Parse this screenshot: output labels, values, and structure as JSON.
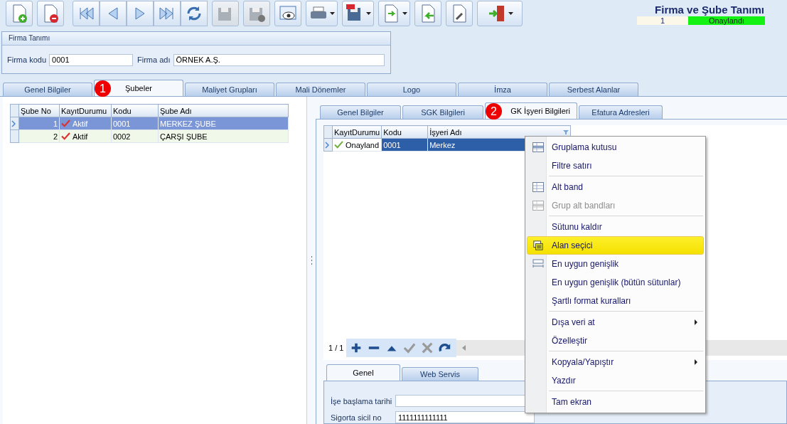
{
  "toolbar": [
    {
      "kind": "new",
      "disabled": false,
      "dropdown": false,
      "group": false
    },
    {
      "kind": "delete",
      "disabled": false,
      "dropdown": false,
      "group": false
    },
    {
      "kind": "first",
      "disabled": false,
      "dropdown": false,
      "group": true
    },
    {
      "kind": "prev",
      "disabled": false,
      "dropdown": false,
      "group": true
    },
    {
      "kind": "next",
      "disabled": false,
      "dropdown": false,
      "group": true
    },
    {
      "kind": "last",
      "disabled": false,
      "dropdown": false,
      "group": true
    },
    {
      "kind": "refresh",
      "disabled": false,
      "dropdown": false,
      "group": true
    },
    {
      "kind": "save",
      "disabled": true,
      "dropdown": false,
      "group": false
    },
    {
      "kind": "save-cancel",
      "disabled": true,
      "dropdown": false,
      "group": false
    },
    {
      "kind": "preview",
      "disabled": false,
      "dropdown": false,
      "group": false
    },
    {
      "kind": "print",
      "disabled": false,
      "dropdown": true,
      "group": false
    },
    {
      "kind": "pdf",
      "disabled": false,
      "dropdown": true,
      "group": false
    },
    {
      "kind": "copy",
      "disabled": false,
      "dropdown": true,
      "group": false
    },
    {
      "kind": "back",
      "disabled": false,
      "dropdown": false,
      "group": false
    },
    {
      "kind": "tools",
      "disabled": false,
      "dropdown": false,
      "group": false
    },
    {
      "kind": "exit",
      "disabled": false,
      "dropdown": true,
      "group": false
    }
  ],
  "window": {
    "title": "Firma ve Şube Tanımı",
    "record": "1",
    "status": "Onaylandı"
  },
  "firma": {
    "title": "Firma Tanımı",
    "code_label": "Firma kodu",
    "code": "0001",
    "name_label": "Firma adı",
    "name": "ÖRNEK A.Ş."
  },
  "tabs": [
    {
      "label": "Genel Bilgiler",
      "selected": false
    },
    {
      "label": "Şubeler",
      "selected": true
    },
    {
      "label": "Maliyet Grupları",
      "selected": false
    },
    {
      "label": "Mali Dönemler",
      "selected": false
    },
    {
      "label": "Logo",
      "selected": false
    },
    {
      "label": "İmza",
      "selected": false
    },
    {
      "label": "Serbest Alanlar",
      "selected": false
    }
  ],
  "annotations": [
    {
      "text": "1"
    },
    {
      "text": "2"
    }
  ],
  "branches": {
    "columns": [
      "Şube No",
      "KayıtDurumu",
      "Kodu",
      "Şube Adı"
    ],
    "rows": [
      {
        "selected": true,
        "no": "1",
        "status": "Aktif",
        "code": "0001",
        "name": "MERKEZ ŞUBE"
      },
      {
        "selected": false,
        "no": "2",
        "status": "Aktif",
        "code": "0002",
        "name": "ÇARŞI ŞUBE"
      }
    ]
  },
  "sub_tabs": [
    {
      "label": "Genel Bilgiler",
      "selected": false
    },
    {
      "label": "SGK Bilgileri",
      "selected": false
    },
    {
      "label": "GK İşyeri Bilgileri",
      "selected": true
    },
    {
      "label": "Efatura Adresleri",
      "selected": false
    }
  ],
  "workplaces": {
    "columns": [
      "KayıtDurumu",
      "Kodu",
      "İşyeri Adı"
    ],
    "rows": [
      {
        "selected": true,
        "status": "Onayland",
        "code": "0001",
        "name": "Merkez"
      }
    ],
    "position": "1 / 1",
    "nav": [
      {
        "kind": "add",
        "disabled": false
      },
      {
        "kind": "remove",
        "disabled": false
      },
      {
        "kind": "up",
        "disabled": false
      },
      {
        "kind": "check",
        "disabled": true
      },
      {
        "kind": "cancel",
        "disabled": true
      },
      {
        "kind": "redo",
        "disabled": false
      }
    ]
  },
  "detail_tabs": [
    {
      "label": "Genel",
      "selected": true
    },
    {
      "label": "Web Servis",
      "selected": false
    }
  ],
  "detail_fields": [
    {
      "label": "İşe başlama tarihi"
    },
    {
      "label": "Sigorta sicil no",
      "value": "1111111111111"
    }
  ],
  "context_menu": [
    {
      "label": "Gruplama kutusu",
      "disabled": false,
      "selected": false,
      "submenu": false,
      "separator_before": false
    },
    {
      "label": "Filtre satırı",
      "disabled": false,
      "selected": false,
      "submenu": false,
      "separator_before": false
    },
    {
      "label": "Alt band",
      "disabled": false,
      "selected": false,
      "submenu": false,
      "separator_before": true
    },
    {
      "label": "Grup alt bandları",
      "disabled": true,
      "selected": false,
      "submenu": false,
      "separator_before": false
    },
    {
      "label": "Sütunu kaldır",
      "disabled": false,
      "selected": false,
      "submenu": false,
      "separator_before": true
    },
    {
      "label": "Alan seçici",
      "disabled": false,
      "selected": true,
      "submenu": false,
      "separator_before": false
    },
    {
      "label": "En uygun genişlik",
      "disabled": false,
      "selected": false,
      "submenu": false,
      "separator_before": false
    },
    {
      "label": "En uygun genişlik (bütün sütunlar)",
      "disabled": false,
      "selected": false,
      "submenu": false,
      "separator_before": false
    },
    {
      "label": "Şartlı format kuralları",
      "disabled": false,
      "selected": false,
      "submenu": false,
      "separator_before": false
    },
    {
      "label": "Dışa veri at",
      "disabled": false,
      "selected": false,
      "submenu": true,
      "separator_before": true
    },
    {
      "label": "Özelleştir",
      "disabled": false,
      "selected": false,
      "submenu": false,
      "separator_before": false
    },
    {
      "label": "Kopyala/Yapıştır",
      "disabled": false,
      "selected": false,
      "submenu": true,
      "separator_before": true
    },
    {
      "label": "Yazdır",
      "disabled": false,
      "selected": false,
      "submenu": false,
      "separator_before": false
    },
    {
      "label": "Tam ekran",
      "disabled": false,
      "selected": false,
      "submenu": false,
      "separator_before": true
    }
  ]
}
